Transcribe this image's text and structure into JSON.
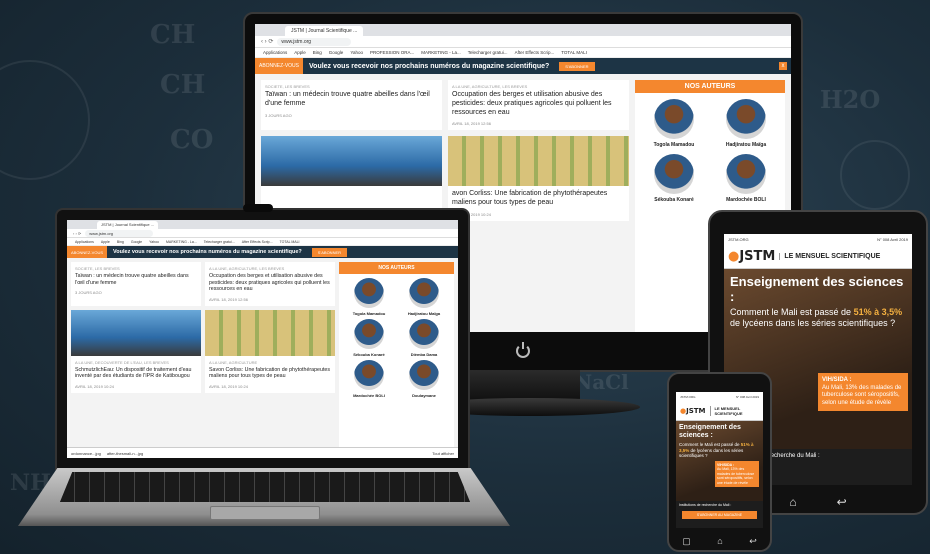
{
  "background": {
    "color": "#1c2e3b",
    "chalk": [
      "CH",
      "CH",
      "CO",
      "H2O",
      "2NaCl",
      "NH"
    ]
  },
  "accent_color": "#f4872e",
  "site": {
    "tab_title": "JSTM | Journal Scientifique ...",
    "security": "Non sécurisé",
    "url": "www.jstm.org",
    "bookmarks": [
      "Applications",
      "Apple",
      "Bing",
      "Google",
      "Yahoo",
      "PROFESSION ORA...",
      "MARKETING - La...",
      "Telecharger gratui...",
      "After Effects Scrip...",
      "TOTAL MALI"
    ],
    "promo": {
      "tag": "ABONNEZ-VOUS",
      "text": "Voulez vous recevoir nos prochains numéros du magazine scientifique?",
      "button": "S'ABONNER",
      "close": "x"
    },
    "articles": [
      {
        "category": "SOCIETE, LES BREVES",
        "title": "Taïwan : un médecin trouve quatre abeilles dans l'œil d'une femme",
        "date": "3 JOURS AGO"
      },
      {
        "category": "A LA UNE, AGRICULTURE, LES BREVES",
        "title": "Occupation des berges et utilisation abusive des pesticides: deux pratiques agricoles qui polluent les ressources en eau",
        "date": "AVRIL 18, 2019 12:56"
      },
      {
        "category": "A LA UNE, DECOUVERTE DE L'EAU, LES BREVES",
        "title": "SchmutzlichEau: Un dispositif de traitement d'eau inventé par des étudiants de l'IPR de Katibougou",
        "date": "AVRIL 18, 2019 10:24"
      },
      {
        "category": "A LA UNE, AGRICULTURE",
        "title": "Savon Corliss: Une fabrication de phytothérapeutes maliens pour tous types de peau",
        "date": "AVRIL 18, 2019 10:24"
      }
    ],
    "monitor_visible_title": "avon Corliss: Une fabrication de phytothérapeutes maliens pour tous types de peau",
    "authors_heading": "NOS AUTEURS",
    "authors": [
      "Togola Mamadou",
      "Hadjiratou Maïga",
      "Sékouba Konaré",
      "Dièmba Dama",
      "Mardochée BOLI",
      "Doulaymane"
    ],
    "downloads": [
      "ordonnance...jpg",
      "after-thesmali-n...jpg"
    ],
    "show_all": "Tout afficher"
  },
  "magazine": {
    "top_left": "JSTM.ORG",
    "top_right": "N° 008 Avril 2019",
    "logo_prefix": "JSTM",
    "masthead": "LE MENSUEL SCIENTIFIQUE",
    "headline": "Enseignement des sciences :",
    "body_pre": "Comment le Mali est passé de ",
    "body_hl": "51% à 3,5%",
    "body_post": " de lycéens dans les séries scientifiques ?",
    "box_title": "VIH/SIDA :",
    "box_text": "Au Mali, 13% des malades de tuberculose sont séropositifs, selon une étude de révèle",
    "footer": "Institutions de recherche du Mali :",
    "subscribe": "S'ABONNER AU MAGAZINE"
  }
}
